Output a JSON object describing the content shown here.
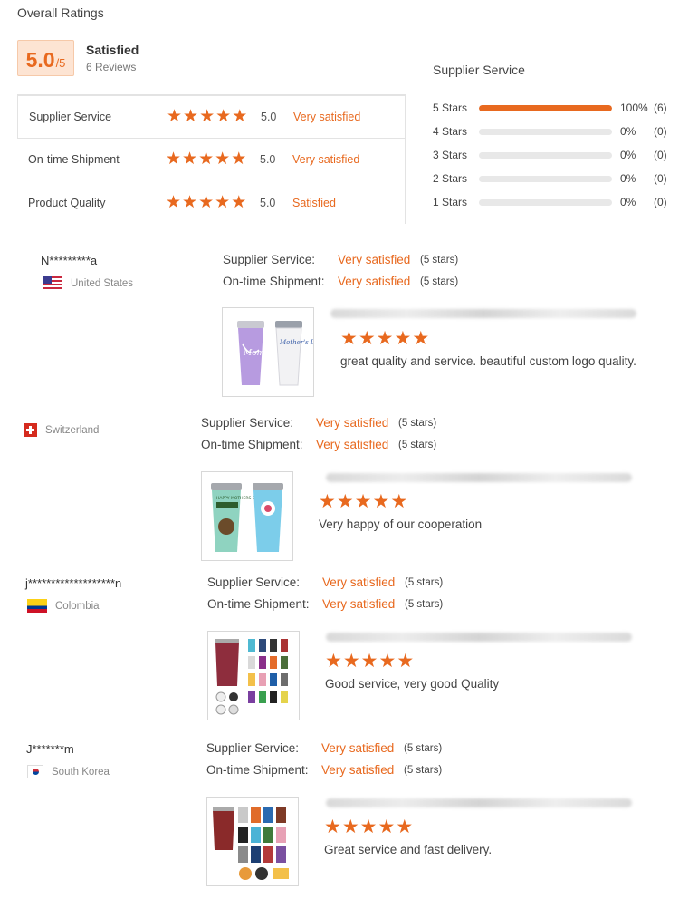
{
  "overall": {
    "title": "Overall Ratings",
    "score": "5.0",
    "score_max": "/5",
    "satisfaction": "Satisfied",
    "reviews_count": "6 Reviews"
  },
  "ratings": [
    {
      "label": "Supplier Service",
      "stars": 5,
      "value": "5.0",
      "desc": "Very satisfied"
    },
    {
      "label": "On-time Shipment",
      "stars": 5,
      "value": "5.0",
      "desc": "Very satisfied"
    },
    {
      "label": "Product Quality",
      "stars": 5,
      "value": "5.0",
      "desc": "Satisfied"
    }
  ],
  "breakdown": {
    "title": "Supplier Service",
    "rows": [
      {
        "label": "5 Stars",
        "percent": 100,
        "pct_text": "100%",
        "count": "(6)"
      },
      {
        "label": "4 Stars",
        "percent": 0,
        "pct_text": "0%",
        "count": "(0)"
      },
      {
        "label": "3 Stars",
        "percent": 0,
        "pct_text": "0%",
        "count": "(0)"
      },
      {
        "label": "2 Stars",
        "percent": 0,
        "pct_text": "0%",
        "count": "(0)"
      },
      {
        "label": "1 Stars",
        "percent": 0,
        "pct_text": "0%",
        "count": "(0)"
      }
    ]
  },
  "labels": {
    "supplier_service": "Supplier Service:",
    "ontime_shipment": "On-time Shipment:",
    "star_glyph": "★"
  },
  "reviews": [
    {
      "name": "N*********a",
      "country": "United States",
      "supplier_service": "Very satisfied",
      "supplier_service_stars": "(5 stars)",
      "ontime_shipment": "Very satisfied",
      "ontime_shipment_stars": "(5 stars)",
      "rating": 5,
      "text": "great quality and service. beautiful custom logo quality.",
      "thumb_text_1": "Mom",
      "thumb_text_2": "Mother's Day"
    },
    {
      "name": "",
      "country": "Switzerland",
      "supplier_service": "Very satisfied",
      "supplier_service_stars": "(5 stars)",
      "ontime_shipment": "Very satisfied",
      "ontime_shipment_stars": "(5 stars)",
      "rating": 5,
      "text": "Very happy of our cooperation",
      "thumb_text_1": "HAPPY MOTHERS DAY",
      "thumb_text_2": ""
    },
    {
      "name": "j*******************n",
      "country": "Colombia",
      "supplier_service": "Very satisfied",
      "supplier_service_stars": "(5 stars)",
      "ontime_shipment": "Very satisfied",
      "ontime_shipment_stars": "(5 stars)",
      "rating": 5,
      "text": "Good service, very good Quality"
    },
    {
      "name": "J*******m",
      "country": "South Korea",
      "supplier_service": "Very satisfied",
      "supplier_service_stars": "(5 stars)",
      "ontime_shipment": "Very satisfied",
      "ontime_shipment_stars": "(5 stars)",
      "rating": 5,
      "text": "Great service and fast delivery."
    }
  ],
  "colors": {
    "accent": "#e8691f",
    "accent_bg": "#fde4d3",
    "track": "#e8e8e8"
  }
}
